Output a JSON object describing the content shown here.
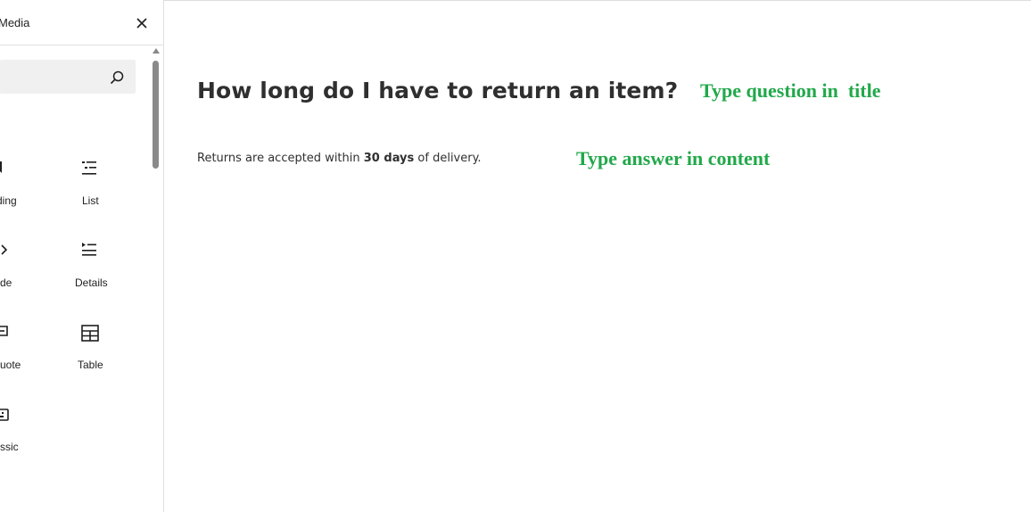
{
  "sidebar": {
    "tab_label": "Media",
    "close_label": "×",
    "search": {
      "placeholder": "",
      "value": ""
    },
    "blocks": [
      {
        "label": "ding",
        "icon": "heading-icon"
      },
      {
        "label": "List",
        "icon": "list-icon"
      },
      {
        "label": "de",
        "icon": "code-icon"
      },
      {
        "label": "Details",
        "icon": "details-icon"
      },
      {
        "label": "uote",
        "icon": "quote-icon"
      },
      {
        "label": "Table",
        "icon": "table-icon"
      },
      {
        "label": "ssic",
        "icon": "classic-icon"
      }
    ]
  },
  "editor": {
    "title": "How long do I have to return an item?",
    "content": {
      "before": "Returns are accepted within ",
      "bold": "30 days",
      "after": " of delivery."
    }
  },
  "annotations": {
    "title_hint": "Type question in  title",
    "content_hint": "Type answer in content",
    "color": "#22a84a"
  }
}
